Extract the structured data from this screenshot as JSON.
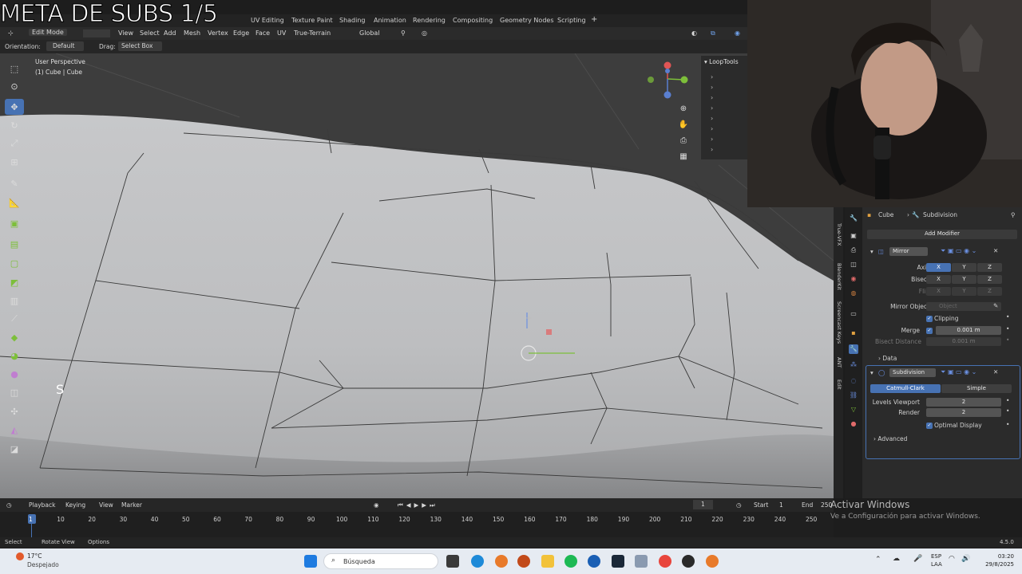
{
  "overlay": {
    "title": "META DE SUBS 1/5"
  },
  "topbar": {
    "workspaces": [
      "UV Editing",
      "Texture Paint",
      "Shading",
      "Animation",
      "Rendering",
      "Compositing",
      "Geometry Nodes",
      "Scripting"
    ],
    "add": "+"
  },
  "header": {
    "mode": "Edit Mode",
    "menus": [
      "View",
      "Select",
      "Add",
      "Mesh",
      "Vertex",
      "Edge",
      "Face",
      "UV",
      "True-Terrain"
    ],
    "transform": "Global"
  },
  "toolrow": {
    "orientation_label": "Orientation:",
    "orientation_value": "Default",
    "drag_label": "Drag:",
    "drag_value": "Select Box"
  },
  "viewport": {
    "perspective": "User Perspective",
    "object": "(1) Cube | Cube",
    "key_hint": "S"
  },
  "looptools": {
    "title": "LoopTools"
  },
  "ntabs": [
    "True-VFX",
    "BlenderKit",
    "Screencast Keys",
    "ANT",
    "Edit"
  ],
  "properties": {
    "breadcrumb_object": "Cube",
    "breadcrumb_modifier": "Subdivision",
    "add_modifier": "Add Modifier",
    "mirror": {
      "name": "Mirror",
      "axis_label": "Axis",
      "bisect_label": "Bisect",
      "flip_label": "Flip",
      "axes": [
        "X",
        "Y",
        "Z"
      ],
      "mirror_object_label": "Mirror Object",
      "mirror_object_placeholder": "Object",
      "clipping": "Clipping",
      "merge_label": "Merge",
      "merge_value": "0.001 m",
      "bisect_distance_label": "Bisect Distance",
      "bisect_distance_value": "0.001 m",
      "data": "Data"
    },
    "subdivision": {
      "name": "Subdivision",
      "type_a": "Catmull-Clark",
      "type_b": "Simple",
      "levels_viewport_label": "Levels Viewport",
      "levels_viewport_value": "2",
      "render_label": "Render",
      "render_value": "2",
      "optimal_display": "Optimal Display",
      "advanced": "Advanced"
    }
  },
  "timeline": {
    "menus": [
      "Playback",
      "Keying",
      "View",
      "Marker"
    ],
    "current_frame": "1",
    "start_label": "Start",
    "start_value": "1",
    "end_label": "End",
    "end_value": "250",
    "ticks": [
      "1",
      "10",
      "20",
      "30",
      "40",
      "50",
      "60",
      "70",
      "80",
      "90",
      "100",
      "110",
      "120",
      "130",
      "140",
      "150",
      "160",
      "170",
      "180",
      "190",
      "200",
      "210",
      "220",
      "230",
      "240",
      "250"
    ]
  },
  "status": {
    "select": "Select",
    "rotate": "Rotate View",
    "options": "Options",
    "version": "4.5.0"
  },
  "watermark": {
    "line1": "Activar Windows",
    "line2": "Ve a Configuración para activar Windows."
  },
  "taskbar": {
    "weather_temp": "17°C",
    "weather_desc": "Despejado",
    "search_placeholder": "Búsqueda",
    "lang1": "ESP",
    "lang2": "LAA",
    "time": "03:20",
    "date": "29/8/2025"
  }
}
